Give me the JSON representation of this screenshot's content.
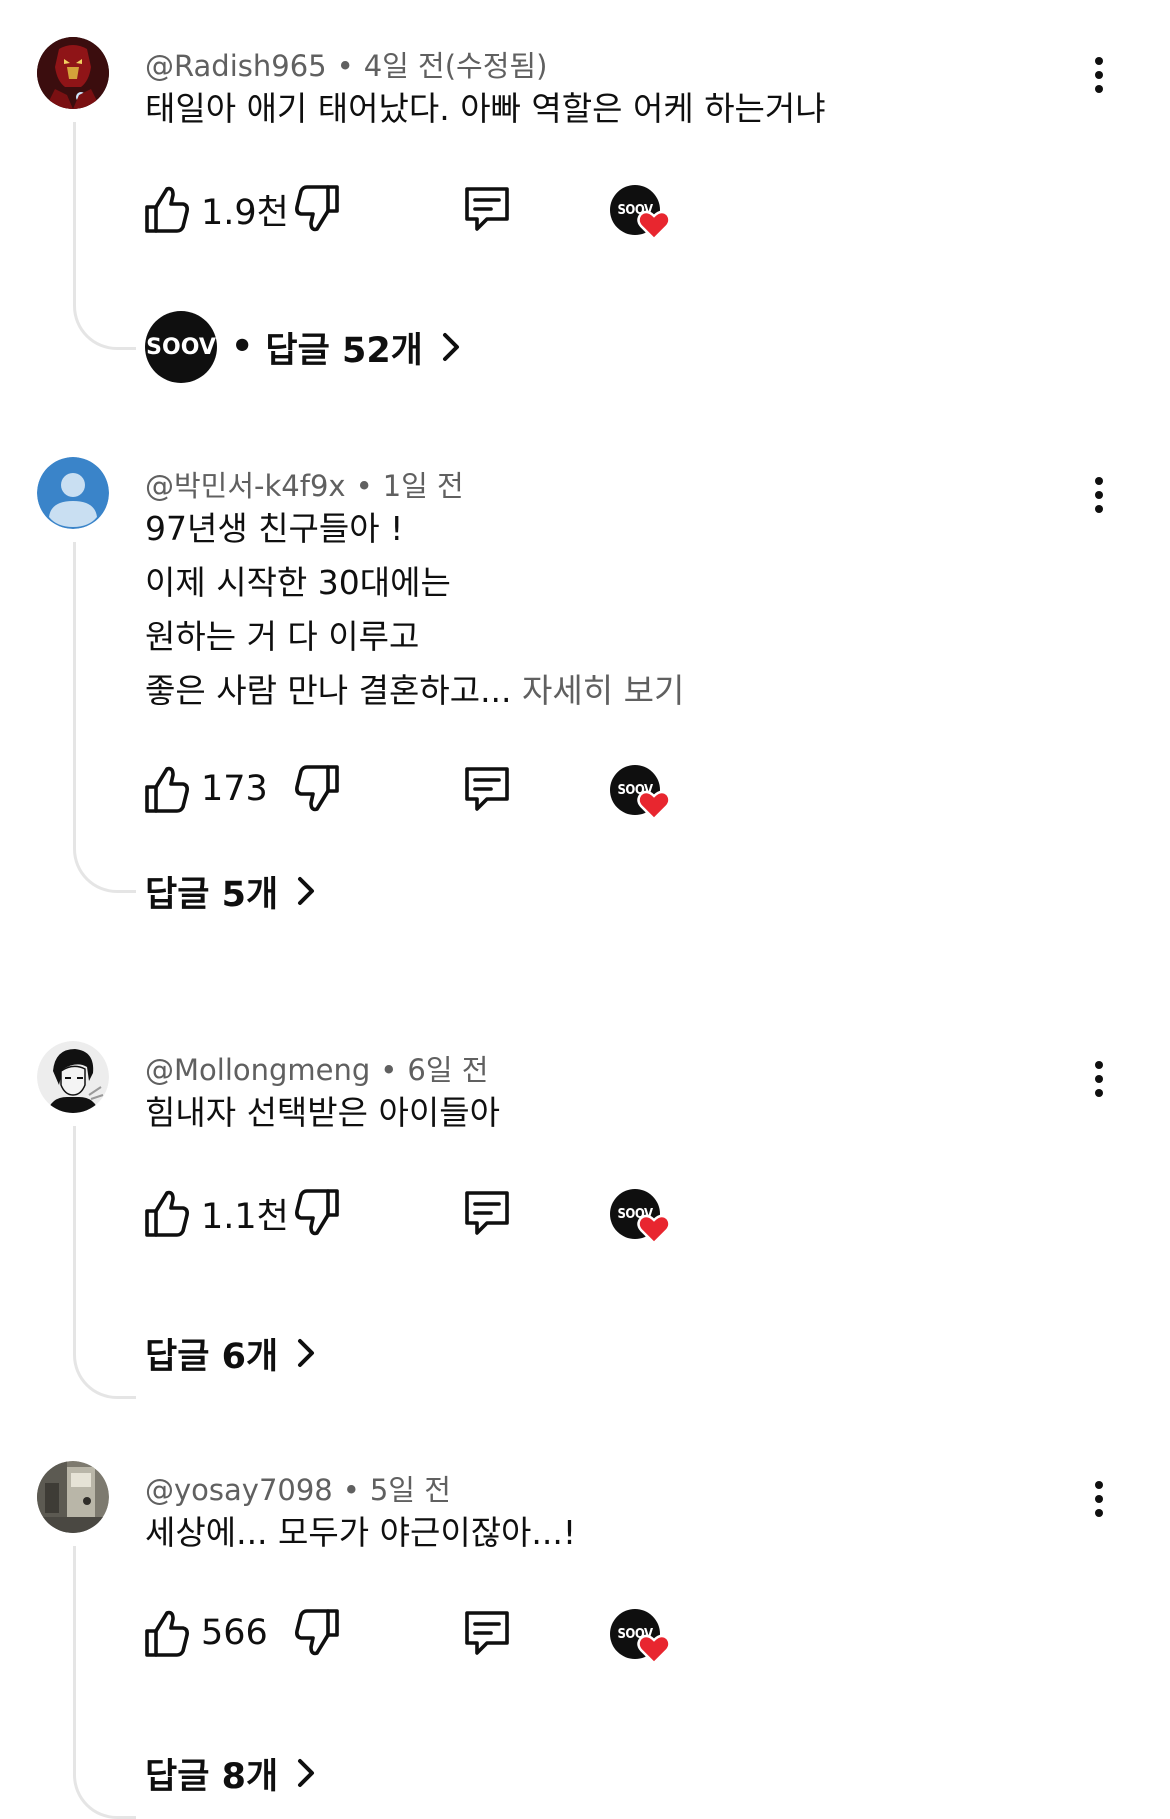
{
  "comments": [
    {
      "author": "@Radish965",
      "time": "4일 전(수정됨)",
      "text": [
        "태일아 애기 태어났다. 아빠 역할은 어케 하는거냐"
      ],
      "more": "",
      "likes": "1.9천",
      "creator_badge": "SOOV",
      "replies": "답글 52개",
      "replies_prefix": "•",
      "avatar": "iron-man",
      "creator_reply_avatar": "SOOV"
    },
    {
      "author": "@박민서-k4f9x",
      "time": "1일 전",
      "text": [
        "97년생 친구들아 !",
        "이제 시작한 30대에는",
        "원하는 거 다 이루고",
        "좋은 사람 만나 결혼하고..."
      ],
      "more": "자세히 보기",
      "likes": "173",
      "creator_badge": "SOOV",
      "replies": "답글 5개",
      "avatar": "default-person"
    },
    {
      "author": "@Mollongmeng",
      "time": "6일 전",
      "text": [
        "힘내자 선택받은 아이들아"
      ],
      "more": "",
      "likes": "1.1천",
      "creator_badge": "SOOV",
      "replies": "답글 6개",
      "avatar": "manga-character"
    },
    {
      "author": "@yosay7098",
      "time": "5일 전",
      "text": [
        "세상에... 모두가 야근이잖아...!"
      ],
      "more": "",
      "likes": "566",
      "creator_badge": "SOOV",
      "replies": "답글 8개",
      "avatar": "photo"
    }
  ],
  "icons": {
    "like": "thumbs-up-icon",
    "dislike": "thumbs-down-icon",
    "reply": "comment-icon",
    "more": "more-vertical-icon",
    "chevron": "chevron-right-icon",
    "heart_color": "#e8262f"
  }
}
